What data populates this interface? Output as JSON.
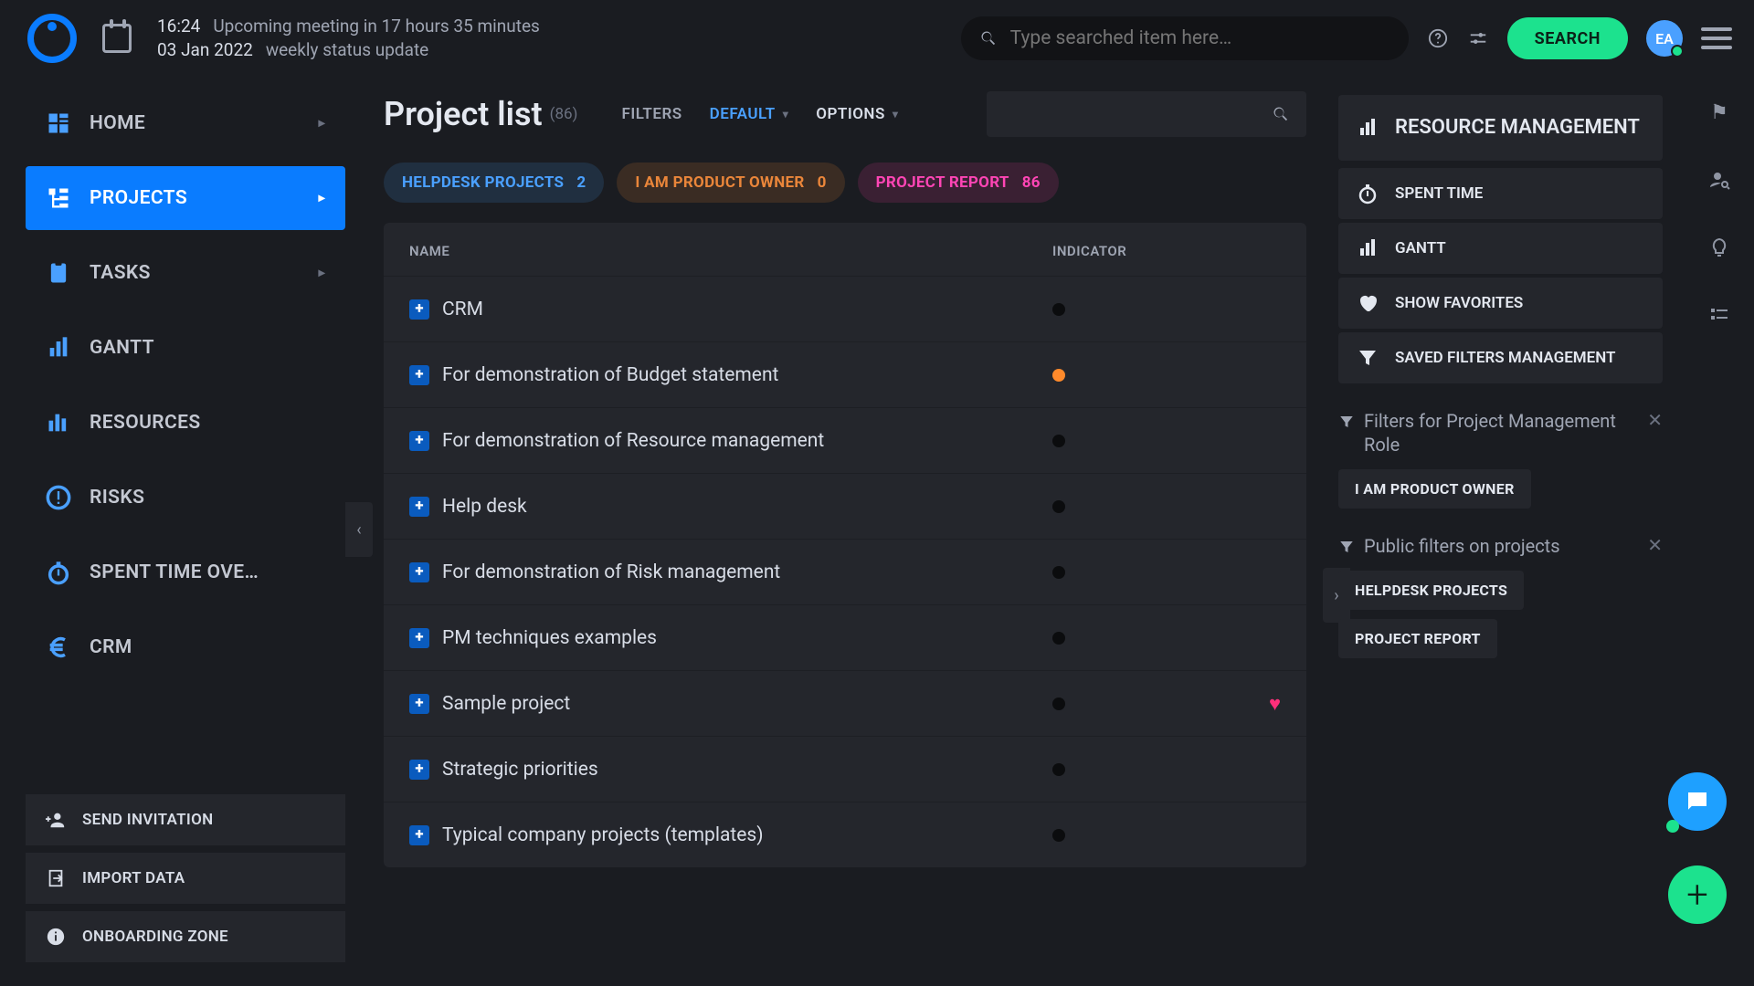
{
  "header": {
    "time": "16:24",
    "date": "03 Jan 2022",
    "eta_line": "Upcoming meeting in 17 hours 35 minutes",
    "meeting_title": "weekly status update",
    "search_placeholder": "Type searched item here…",
    "search_button": "SEARCH",
    "avatar_initials": "EA"
  },
  "sidebar": {
    "items": [
      {
        "label": "HOME",
        "chevron": true
      },
      {
        "label": "PROJECTS",
        "chevron": true
      },
      {
        "label": "TASKS",
        "chevron": true
      },
      {
        "label": "GANTT",
        "chevron": false
      },
      {
        "label": "RESOURCES",
        "chevron": false
      },
      {
        "label": "RISKS",
        "chevron": false
      },
      {
        "label": "SPENT TIME OVE…",
        "chevron": false
      },
      {
        "label": "CRM",
        "chevron": false
      }
    ],
    "bottom": [
      {
        "label": "SEND INVITATION"
      },
      {
        "label": "IMPORT DATA"
      },
      {
        "label": "ONBOARDING ZONE"
      }
    ]
  },
  "main": {
    "title": "Project list",
    "count": "(86)",
    "toolbar": {
      "filters_label": "FILTERS",
      "filters_value": "DEFAULT",
      "options_label": "OPTIONS"
    },
    "chips": [
      {
        "label": "HELPDESK PROJECTS",
        "count": "2"
      },
      {
        "label": "I AM PRODUCT OWNER",
        "count": "0"
      },
      {
        "label": "PROJECT REPORT",
        "count": "86"
      }
    ],
    "columns": {
      "name": "NAME",
      "indicator": "INDICATOR"
    },
    "rows": [
      {
        "name": "CRM",
        "ind": "black",
        "fav": false
      },
      {
        "name": "For demonstration of Budget statement",
        "ind": "orange",
        "fav": false
      },
      {
        "name": "For demonstration of Resource management",
        "ind": "black",
        "fav": false
      },
      {
        "name": "Help desk",
        "ind": "black",
        "fav": false
      },
      {
        "name": "For demonstration of Risk management",
        "ind": "black",
        "fav": false
      },
      {
        "name": "PM techniques examples",
        "ind": "black",
        "fav": false
      },
      {
        "name": "Sample project",
        "ind": "black",
        "fav": true
      },
      {
        "name": "Strategic priorities",
        "ind": "black",
        "fav": false
      },
      {
        "name": "Typical company projects (templates)",
        "ind": "black",
        "fav": false
      }
    ]
  },
  "right": {
    "title": "RESOURCE MANAGEMENT",
    "links": [
      {
        "label": "SPENT TIME"
      },
      {
        "label": "GANTT"
      },
      {
        "label": "SHOW FAVORITES"
      },
      {
        "label": "SAVED FILTERS MANAGEMENT"
      }
    ],
    "filter1_title": "Filters for Project Management Role",
    "filter1_tags": [
      "I AM PRODUCT OWNER"
    ],
    "filter2_title": "Public filters on projects",
    "filter2_tags": [
      "HELPDESK PROJECTS",
      "PROJECT REPORT"
    ]
  }
}
